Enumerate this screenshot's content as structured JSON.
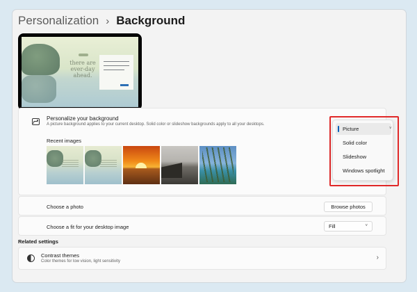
{
  "breadcrumb": {
    "parent": "Personalization",
    "separator": "›",
    "current": "Background"
  },
  "preview": {
    "text": "there are ever-day ahead."
  },
  "personalize": {
    "title": "Personalize your background",
    "description": "A picture background applies to your current desktop. Solid color or slideshow backgrounds apply to all your desktops.",
    "icon": "picture-icon"
  },
  "background_type": {
    "selected": "Picture",
    "options": [
      "Picture",
      "Solid color",
      "Slideshow",
      "Windows spotlight"
    ],
    "chevron": "˅"
  },
  "recent_images": {
    "label": "Recent images",
    "items": [
      "tree-lake-wallpaper",
      "tree-lake-wallpaper",
      "sunset",
      "rocky-coast",
      "palm-beach"
    ]
  },
  "choose_photo": {
    "label": "Choose a photo",
    "button": "Browse photos"
  },
  "fit": {
    "label": "Choose a fit for your desktop image",
    "value": "Fill",
    "chevron": "˅"
  },
  "related": {
    "label": "Related settings"
  },
  "contrast": {
    "title": "Contrast themes",
    "description": "Color themes for low vision, light sensitivity",
    "icon": "contrast-icon",
    "chevron": "›"
  },
  "colors": {
    "highlight": "#e02828",
    "accent": "#005fb8"
  }
}
